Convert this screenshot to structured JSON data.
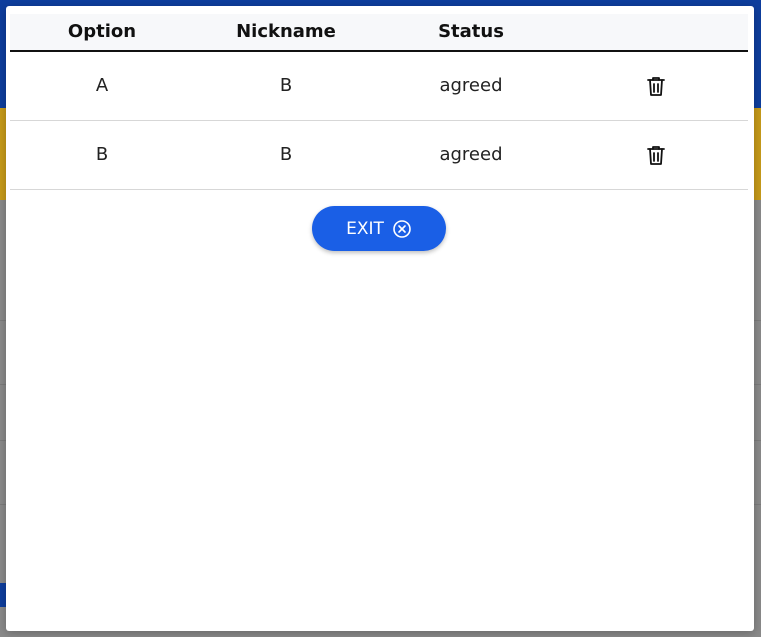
{
  "table": {
    "headers": [
      "Option",
      "Nickname",
      "Status"
    ],
    "rows": [
      {
        "option": "A",
        "nickname": "B",
        "status": "agreed",
        "action_icon": "trash-icon"
      },
      {
        "option": "B",
        "nickname": "B",
        "status": "agreed",
        "action_icon": "trash-icon"
      }
    ]
  },
  "exit_button": {
    "label": "EXIT",
    "icon": "close-circle-icon"
  },
  "colors": {
    "accent": "#1a5fe6",
    "header_bg": "#f7f8fa",
    "background_blue": "#0e3e9e",
    "background_yellow": "#c79b1a"
  }
}
